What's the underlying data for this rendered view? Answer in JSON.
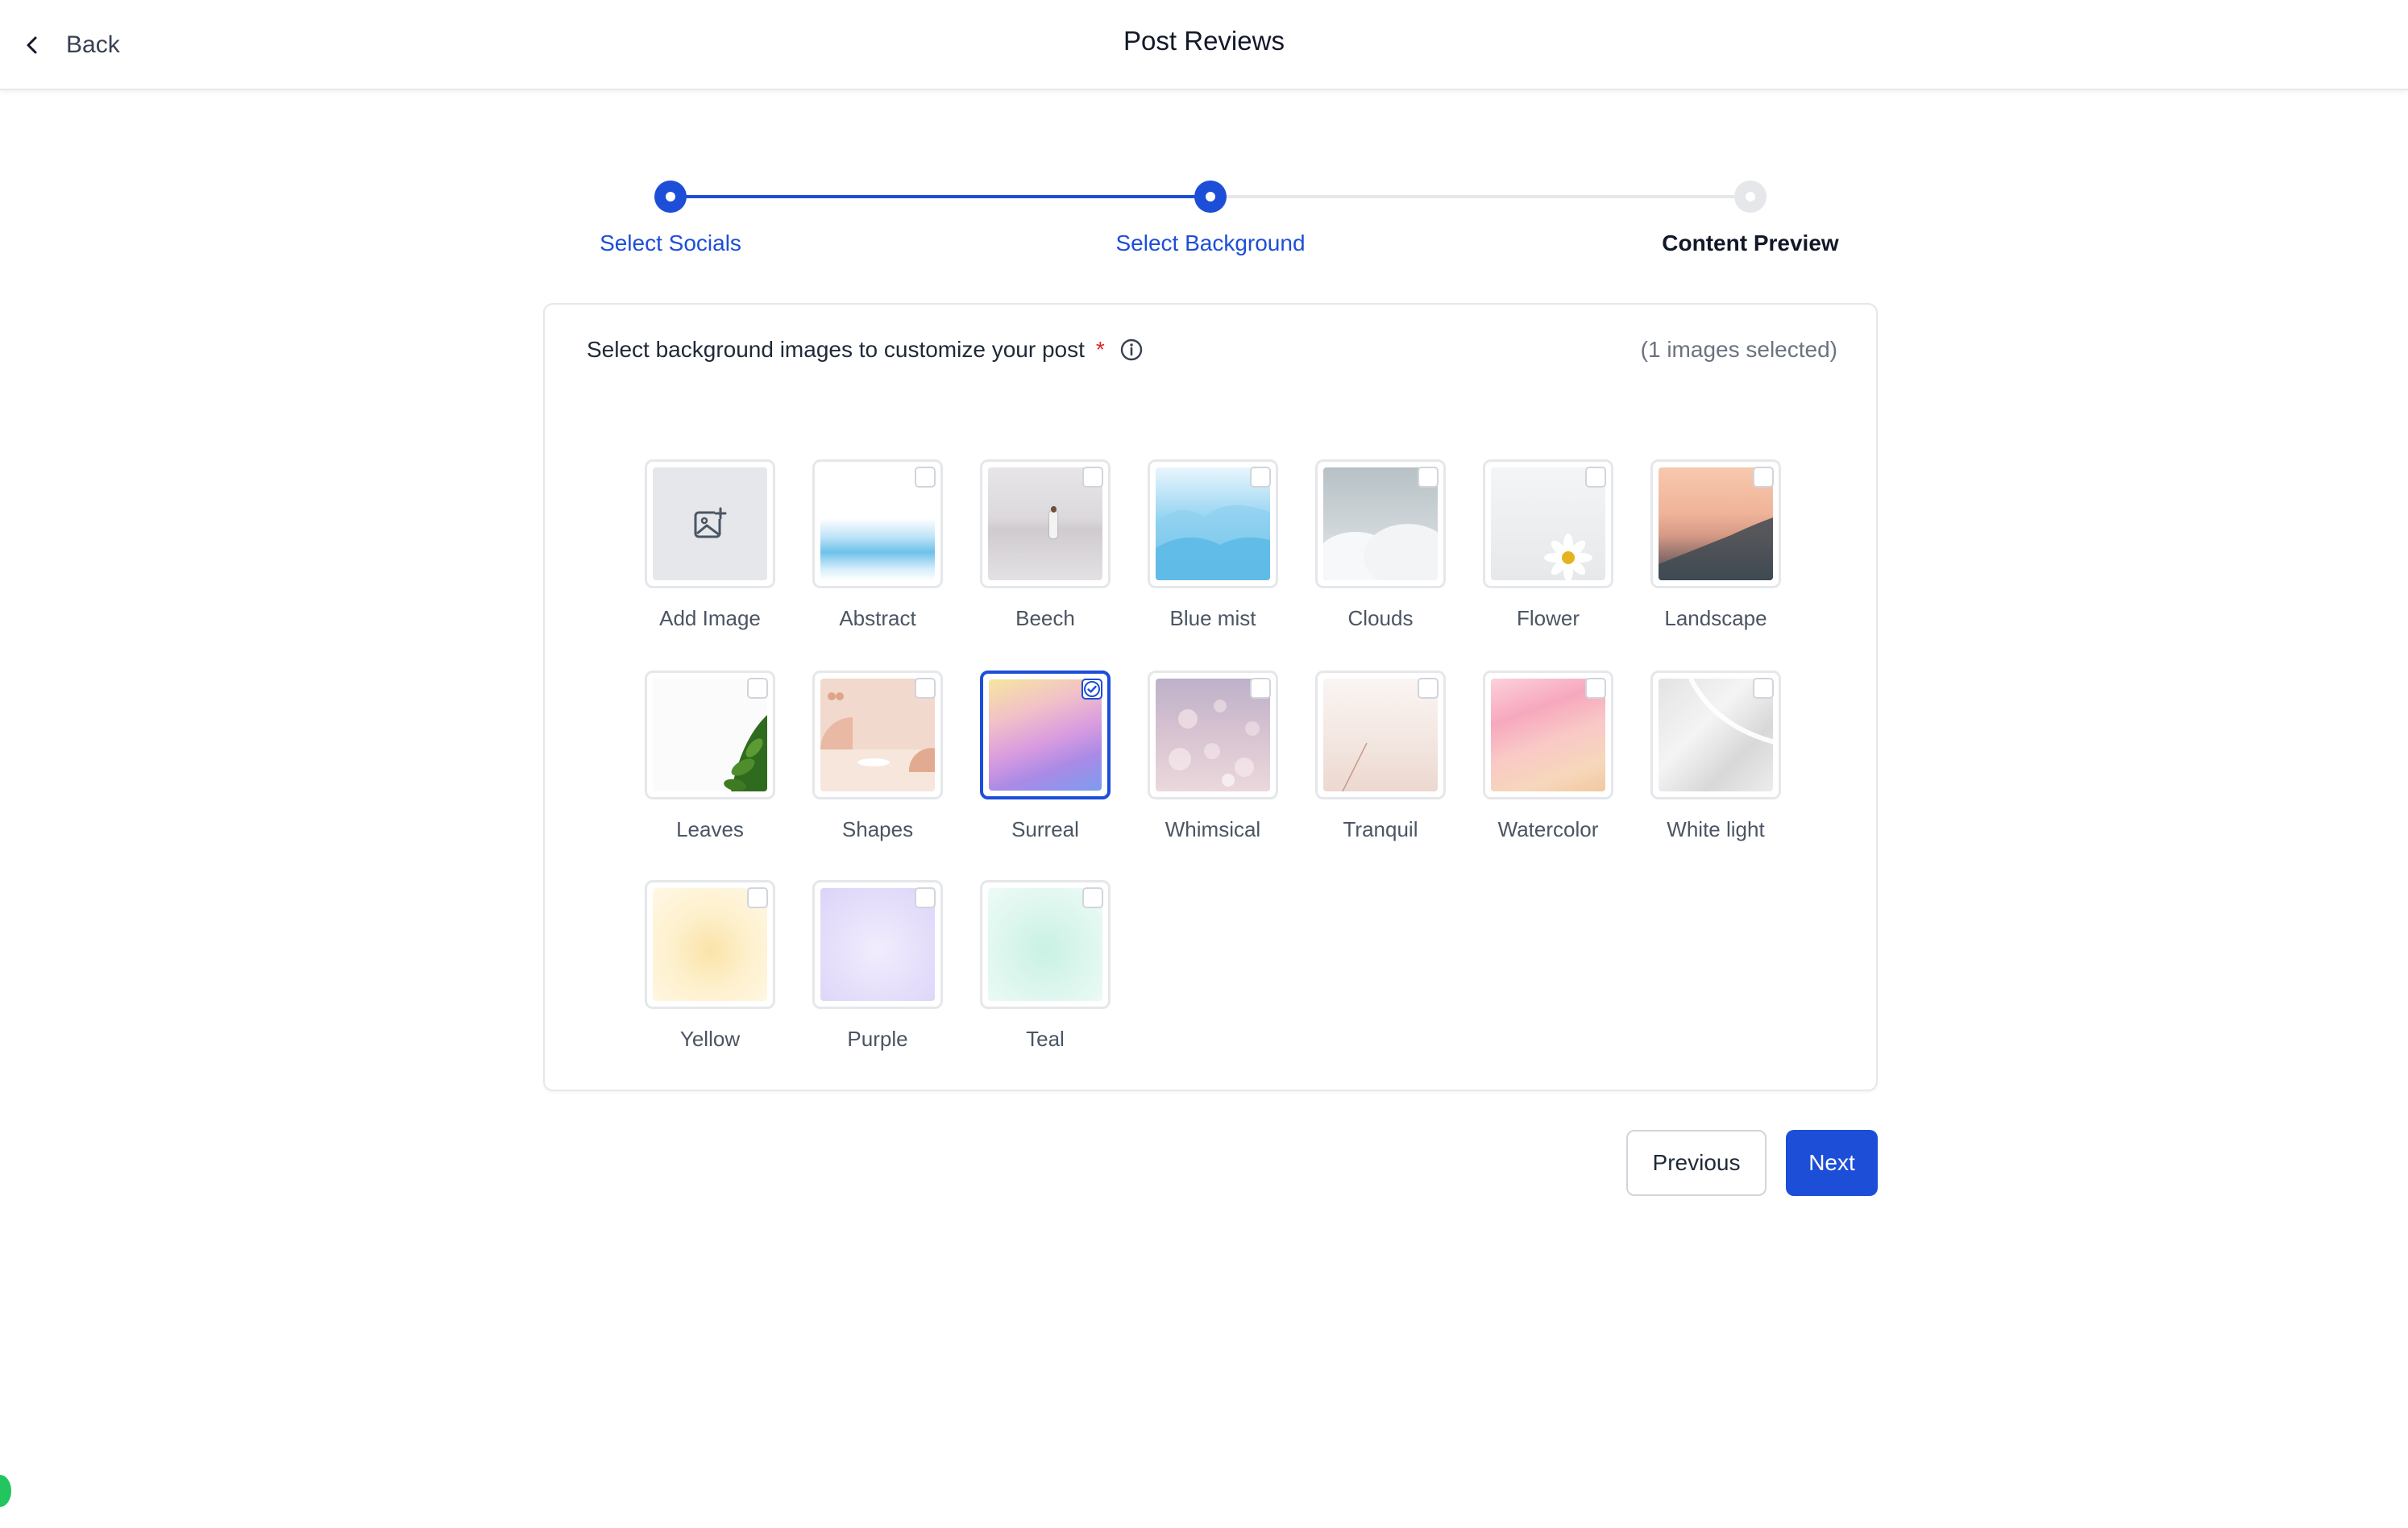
{
  "header": {
    "back_label": "Back",
    "title": "Post Reviews"
  },
  "stepper": {
    "steps": [
      {
        "label": "Select Socials",
        "state": "complete"
      },
      {
        "label": "Select Background",
        "state": "current"
      },
      {
        "label": "Content Preview",
        "state": "pending"
      }
    ]
  },
  "card": {
    "title": "Select background images to customize your post",
    "required_mark": "*",
    "selected_count_text": "(1 images selected)"
  },
  "tiles": [
    {
      "label": "Add Image",
      "kind": "add",
      "checked": false
    },
    {
      "label": "Abstract",
      "checked": false
    },
    {
      "label": "Beech",
      "checked": false
    },
    {
      "label": "Blue mist",
      "checked": false
    },
    {
      "label": "Clouds",
      "checked": false
    },
    {
      "label": "Flower",
      "checked": false
    },
    {
      "label": "Landscape",
      "checked": false
    },
    {
      "label": "Leaves",
      "checked": false
    },
    {
      "label": "Shapes",
      "checked": false
    },
    {
      "label": "Surreal",
      "checked": true
    },
    {
      "label": "Whimsical",
      "checked": false
    },
    {
      "label": "Tranquil",
      "checked": false
    },
    {
      "label": "Watercolor",
      "checked": false
    },
    {
      "label": "White light",
      "checked": false
    },
    {
      "label": "Yellow",
      "checked": false
    },
    {
      "label": "Purple",
      "checked": false
    },
    {
      "label": "Teal",
      "checked": false
    }
  ],
  "actions": {
    "previous_label": "Previous",
    "next_label": "Next"
  },
  "colors": {
    "accent": "#1d4ed8",
    "required": "#dc2626"
  }
}
